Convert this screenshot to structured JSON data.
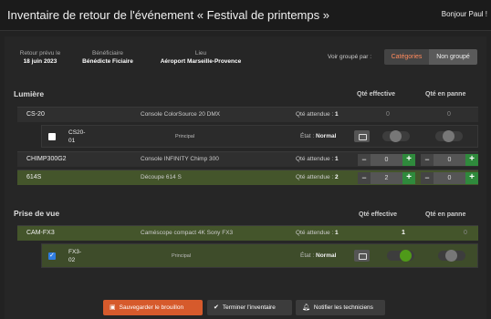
{
  "header": {
    "title": "Inventaire de retour de l'événement « Festival de printemps »",
    "user": "Bonjour Paul !"
  },
  "info": {
    "retour_label": "Retour prévu le",
    "retour_value": "18 juin 2023",
    "benef_label": "Bénéficiaire",
    "benef_value": "Bénédicte Ficiaire",
    "lieu_label": "Lieu",
    "lieu_value": "Aéroport Marseille-Provence"
  },
  "grouping": {
    "label": "Voir groupé par :",
    "options": [
      "Catégories",
      "Non groupé"
    ],
    "selected": "Catégories"
  },
  "columns": {
    "effective": "Qté effective",
    "panne": "Qté en panne"
  },
  "sections": [
    {
      "name": "Lumière",
      "rows": [
        {
          "ref": "CS-20",
          "desc": "Console ColorSource 20 DMX",
          "att_label": "Qté attendue :",
          "att": "1",
          "eff": "0",
          "panne": "0",
          "sub": {
            "ref_l1": "CS20-",
            "ref_l2": "01",
            "principal": "Principal",
            "etat_label": "État :",
            "etat": "Normal"
          }
        },
        {
          "ref": "CHIMP300G2",
          "desc": "Console INFINITY Chimp 300",
          "att_label": "Qté attendue :",
          "att": "1",
          "eff": "0",
          "panne": "0"
        },
        {
          "ref": "614S",
          "desc": "Découpe 614 S",
          "att_label": "Qté attendue :",
          "att": "2",
          "eff": "2",
          "panne": "0"
        }
      ]
    },
    {
      "name": "Prise de vue",
      "rows": [
        {
          "ref": "CAM-FX3",
          "desc": "Caméscope compact 4K Sony FX3",
          "att_label": "Qté attendue :",
          "att": "1",
          "eff": "1",
          "panne": "0",
          "sub": {
            "ref_l1": "FX3-",
            "ref_l2": "02",
            "principal": "Principal",
            "etat_label": "État :",
            "etat": "Normal"
          }
        }
      ]
    }
  ],
  "buttons": {
    "save": "Sauvegarder le brouillon",
    "finish": "Terminer l'inventaire",
    "notify": "Notifier les techniciens"
  },
  "colors": {
    "accent": "#d65a2c",
    "plus": "#2f8a3c",
    "toggle_on": "#4f9a19",
    "row_ok": "#44552b"
  }
}
